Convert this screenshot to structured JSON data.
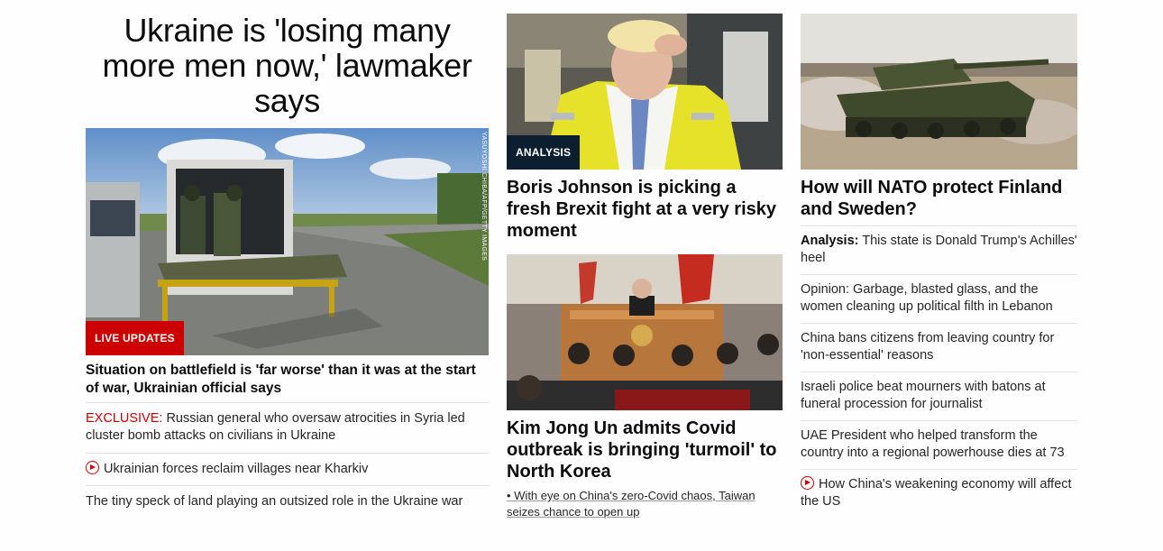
{
  "left": {
    "headline": "Ukraine is 'losing many more men now,' lawmaker says",
    "image_tag": "LIVE UPDATES",
    "photo_credit": "YASUYOSHI CHIBA/AFP/GETTY IMAGES",
    "story_title": "Situation on battlefield is 'far worse' than it was at the start of war, Ukrainian official says",
    "items": [
      {
        "kicker": "EXCLUSIVE:",
        "text": " Russian general who oversaw atrocities in Syria led cluster bomb attacks on civilians in Ukraine"
      },
      {
        "text": "Ukrainian forces reclaim villages near Kharkiv",
        "icon": "play-icon"
      },
      {
        "text": "The tiny speck of land playing an outsized role in the Ukraine war"
      }
    ]
  },
  "middle": {
    "top_tag": "ANALYSIS",
    "top_title": "Boris Johnson is picking a fresh Brexit fight at a very risky moment",
    "bottom_title": "Kim Jong Un admits Covid outbreak is bringing 'turmoil' to North Korea",
    "bottom_link": "• With eye on China's zero-Covid chaos, Taiwan seizes chance to open up"
  },
  "right": {
    "title": "How will NATO protect Finland and Sweden?",
    "items": [
      {
        "kicker": "Analysis:",
        "text": " This state is Donald Trump's Achilles' heel"
      },
      {
        "text": "Opinion: Garbage, blasted glass, and the women cleaning up political filth in Lebanon"
      },
      {
        "text": "China bans citizens from leaving country for 'non-essential' reasons"
      },
      {
        "text": "Israeli police beat mourners with batons at funeral procession for journalist"
      },
      {
        "text": "UAE President who helped transform the country into a regional powerhouse dies at 73"
      },
      {
        "text": "How China's weakening economy will affect the US",
        "icon": "play-icon"
      }
    ]
  },
  "colors": {
    "accent_red": "#cc0000",
    "tag_dark": "#0c1f30"
  }
}
